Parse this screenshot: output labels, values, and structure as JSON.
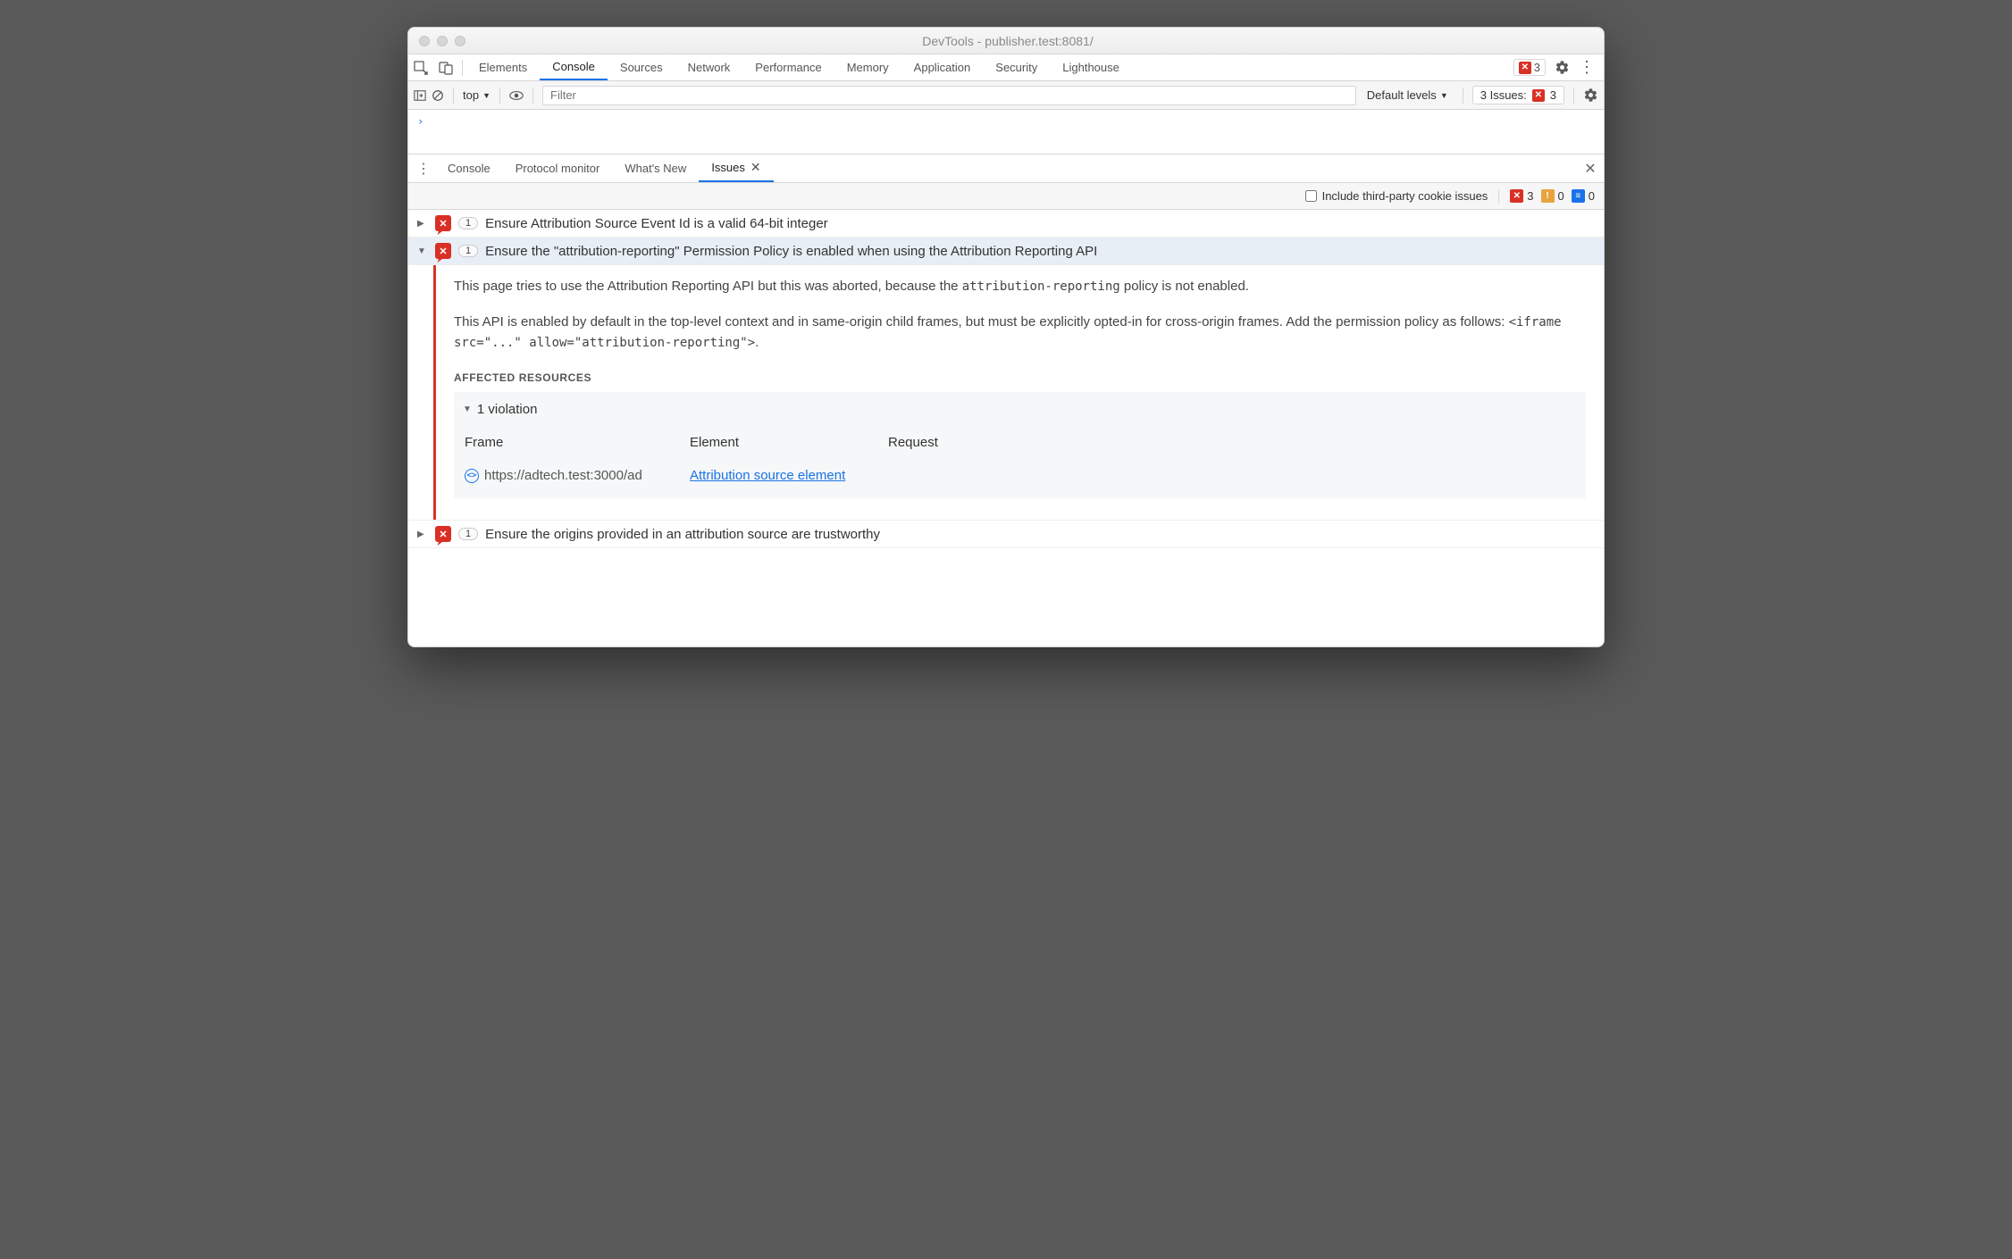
{
  "window_title": "DevTools - publisher.test:8081/",
  "main_tabs": [
    "Elements",
    "Console",
    "Sources",
    "Network",
    "Performance",
    "Memory",
    "Application",
    "Security",
    "Lighthouse"
  ],
  "main_active_tab": "Console",
  "error_count_top": "3",
  "console_toolbar": {
    "context": "top",
    "filter_placeholder": "Filter",
    "levels": "Default levels",
    "issues_label": "3 Issues:",
    "issues_count": "3"
  },
  "console_prompt": "›",
  "drawer_tabs": [
    "Console",
    "Protocol monitor",
    "What's New",
    "Issues"
  ],
  "drawer_active_tab": "Issues",
  "issues_toolbar": {
    "checkbox_label": "Include third-party cookie issues",
    "red_count": "3",
    "orange_count": "0",
    "blue_count": "0"
  },
  "issues": [
    {
      "count": "1",
      "title": "Ensure Attribution Source Event Id is a valid 64-bit integer",
      "expanded": false
    },
    {
      "count": "1",
      "title": "Ensure the \"attribution-reporting\" Permission Policy is enabled when using the Attribution Reporting API",
      "expanded": true
    },
    {
      "count": "1",
      "title": "Ensure the origins provided in an attribution source are trustworthy",
      "expanded": false
    }
  ],
  "detail": {
    "p1_a": "This page tries to use the Attribution Reporting API but this was aborted, because the ",
    "p1_code": "attribution-reporting",
    "p1_b": " policy is not enabled.",
    "p2_a": "This API is enabled by default in the top-level context and in same-origin child frames, but must be explicitly opted-in for cross-origin frames. Add the permission policy as follows: ",
    "p2_code": "<iframe src=\"...\" allow=\"attribution-reporting\">",
    "p2_b": ".",
    "aff_title": "AFFECTED RESOURCES",
    "violation_header": "1 violation",
    "col_frame": "Frame",
    "col_element": "Element",
    "col_request": "Request",
    "frame_url": "https://adtech.test:3000/ad",
    "element_link": "Attribution source element"
  }
}
